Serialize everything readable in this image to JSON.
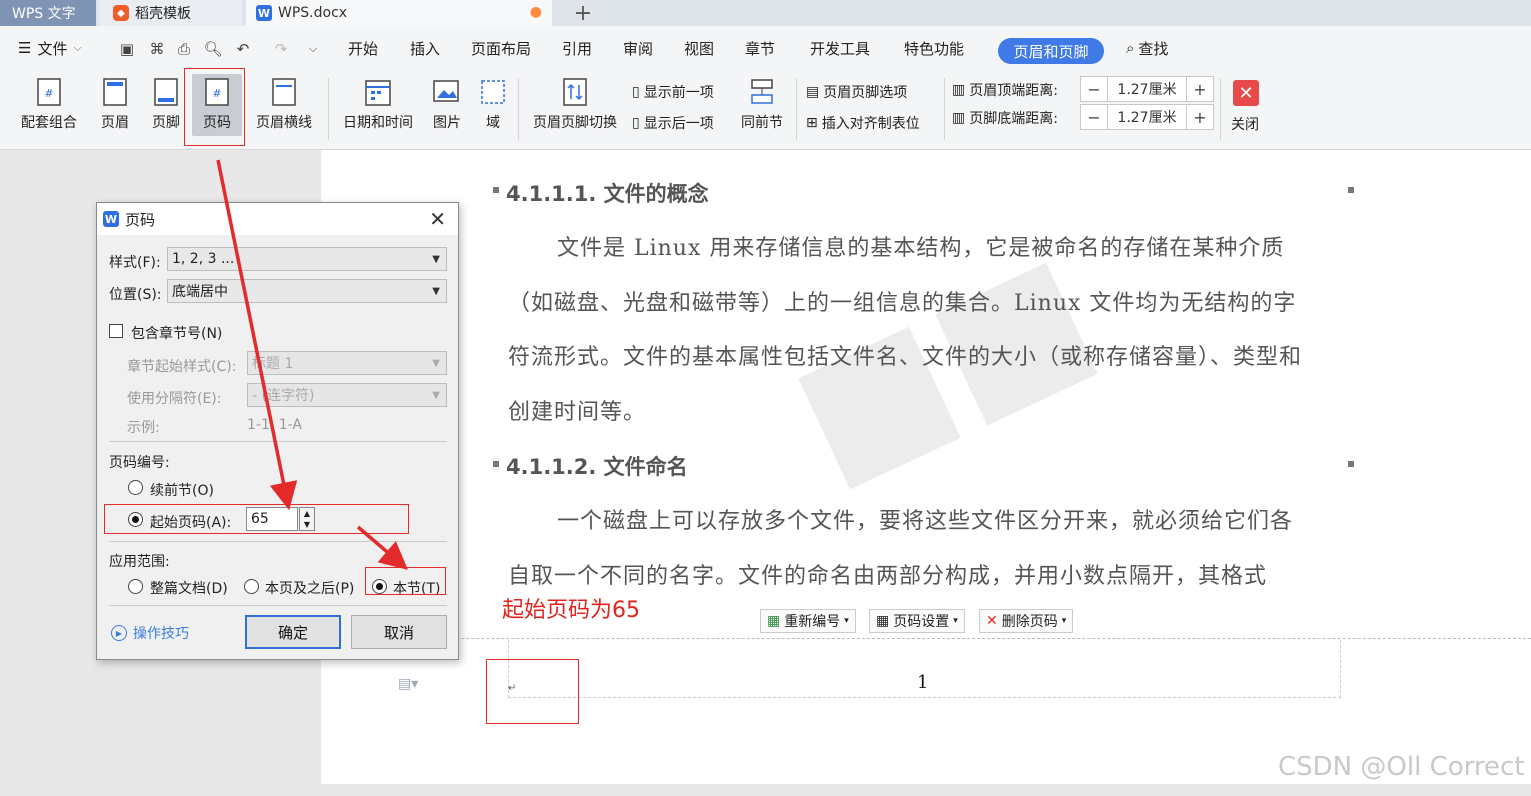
{
  "tabs": {
    "app": "WPS 文字",
    "template": "稻壳模板",
    "doc": "WPS.docx",
    "template_icon": "daoke-logo-icon",
    "doc_icon": "wps-writer-icon",
    "add": "+"
  },
  "menu": {
    "file": "文件",
    "items": [
      "开始",
      "插入",
      "页面布局",
      "引用",
      "审阅",
      "视图",
      "章节",
      "开发工具",
      "特色功能"
    ],
    "active": "页眉和页脚",
    "search": "查找"
  },
  "ribbon": {
    "combo": "配套组合",
    "header": "页眉",
    "footer": "页脚",
    "page_number": "页码",
    "header_line": "页眉横线",
    "datetime": "日期和时间",
    "picture": "图片",
    "field": "域",
    "hf_switch": "页眉页脚切换",
    "show_prev": "显示前一项",
    "show_next": "显示后一项",
    "same_as_prev": "同前节",
    "hf_options": "页眉页脚选项",
    "insert_tab": "插入对齐制表位",
    "header_top_dist": "页眉顶端距离:",
    "footer_bottom_dist": "页脚底端距离:",
    "header_top_value": "1.27厘米",
    "footer_bottom_value": "1.27厘米",
    "close": "关闭"
  },
  "document": {
    "heading1": "4.1.1.1. 文件的概念",
    "para1": [
      "文件是 Linux 用来存储信息的基本结构，它是被命名的存储在某种介质",
      "（如磁盘、光盘和磁带等）上的一组信息的集合。Linux 文件均为无结构的字",
      "符流形式。文件的基本属性包括文件名、文件的大小（或称存储容量）、类型和",
      "创建时间等。"
    ],
    "heading2": "4.1.1.2. 文件命名",
    "para2": [
      "一个磁盘上可以存放多个文件，要将这些文件区分开来，就必须给它们各",
      "自取一个不同的名字。文件的命名由两部分构成，并用小数点隔开，其格式"
    ],
    "annotation": "起始页码为65",
    "footer_page_number": "1"
  },
  "footer_toolbar": {
    "renumber": "重新编号",
    "page_setup": "页码设置",
    "delete": "删除页码"
  },
  "dialog": {
    "title": "页码",
    "style_label": "样式(F):",
    "style_value": "1, 2, 3 ...",
    "position_label": "位置(S):",
    "position_value": "底端居中",
    "include_chapter": "包含章节号(N)",
    "chapter_style_label": "章节起始样式(C):",
    "chapter_style_value": "标题 1",
    "separator_label": "使用分隔符(E):",
    "separator_value": "-   (连字符)",
    "example_label": "示例:",
    "example_value": "1-1, 1-A",
    "numbering_label": "页码编号:",
    "continue": "续前节(O)",
    "start_at": "起始页码(A):",
    "start_value": "65",
    "scope_label": "应用范围:",
    "scope_whole": "整篇文档(D)",
    "scope_after": "本页及之后(P)",
    "scope_section": "本节(T)",
    "tips": "操作技巧",
    "ok": "确定",
    "cancel": "取消"
  },
  "watermark_text": "CSDN @Oll Correct",
  "colors": {
    "accent": "#3f7ae6",
    "annotation": "#e3231e",
    "close_button": "#e84a4a"
  }
}
